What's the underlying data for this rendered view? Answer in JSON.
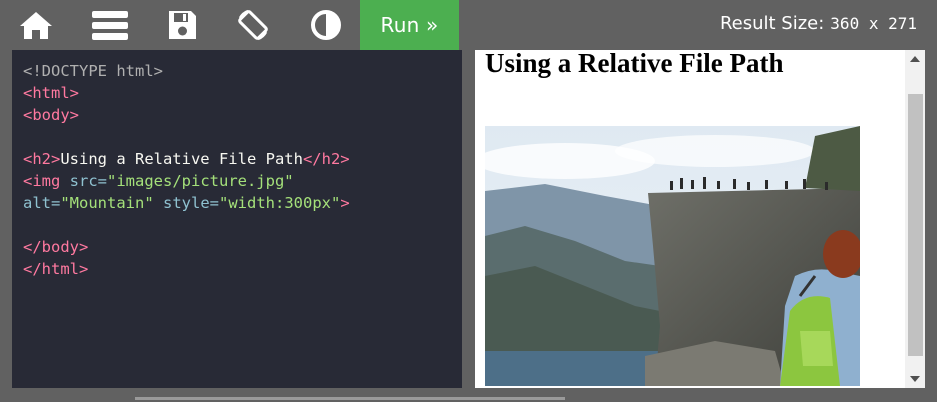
{
  "toolbar": {
    "icons": [
      "home-icon",
      "menu-icon",
      "save-icon",
      "rotate-icon",
      "contrast-icon"
    ],
    "run_label": "Run »",
    "result_size_label": "Result Size:",
    "result_size_value": "360 x 271"
  },
  "editor": {
    "lines": [
      [
        {
          "t": "doc",
          "v": "<!DOCTYPE html>"
        }
      ],
      [
        {
          "t": "tag",
          "v": "<html>"
        }
      ],
      [
        {
          "t": "tag",
          "v": "<body>"
        }
      ],
      [],
      [
        {
          "t": "tag",
          "v": "<h2>"
        },
        {
          "t": "txt",
          "v": "Using a Relative File Path"
        },
        {
          "t": "tag",
          "v": "</h2>"
        }
      ],
      [
        {
          "t": "tag",
          "v": "<img "
        },
        {
          "t": "attr",
          "v": "src="
        },
        {
          "t": "str",
          "v": "\"images/picture.jpg\""
        }
      ],
      [
        {
          "t": "attr",
          "v": "alt="
        },
        {
          "t": "str",
          "v": "\"Mountain\""
        },
        {
          "t": "txt",
          "v": " "
        },
        {
          "t": "attr",
          "v": "style="
        },
        {
          "t": "str",
          "v": "\"width:300px\""
        },
        {
          "t": "tag",
          "v": ">"
        }
      ],
      [],
      [
        {
          "t": "tag",
          "v": "</body>"
        }
      ],
      [
        {
          "t": "tag",
          "v": "</html>"
        }
      ]
    ]
  },
  "result": {
    "heading": "Using a Relative File Path",
    "image_alt": "Mountain"
  },
  "colors": {
    "toolbar_bg": "#616161",
    "run_button": "#4caf50",
    "editor_bg": "#282a36"
  }
}
